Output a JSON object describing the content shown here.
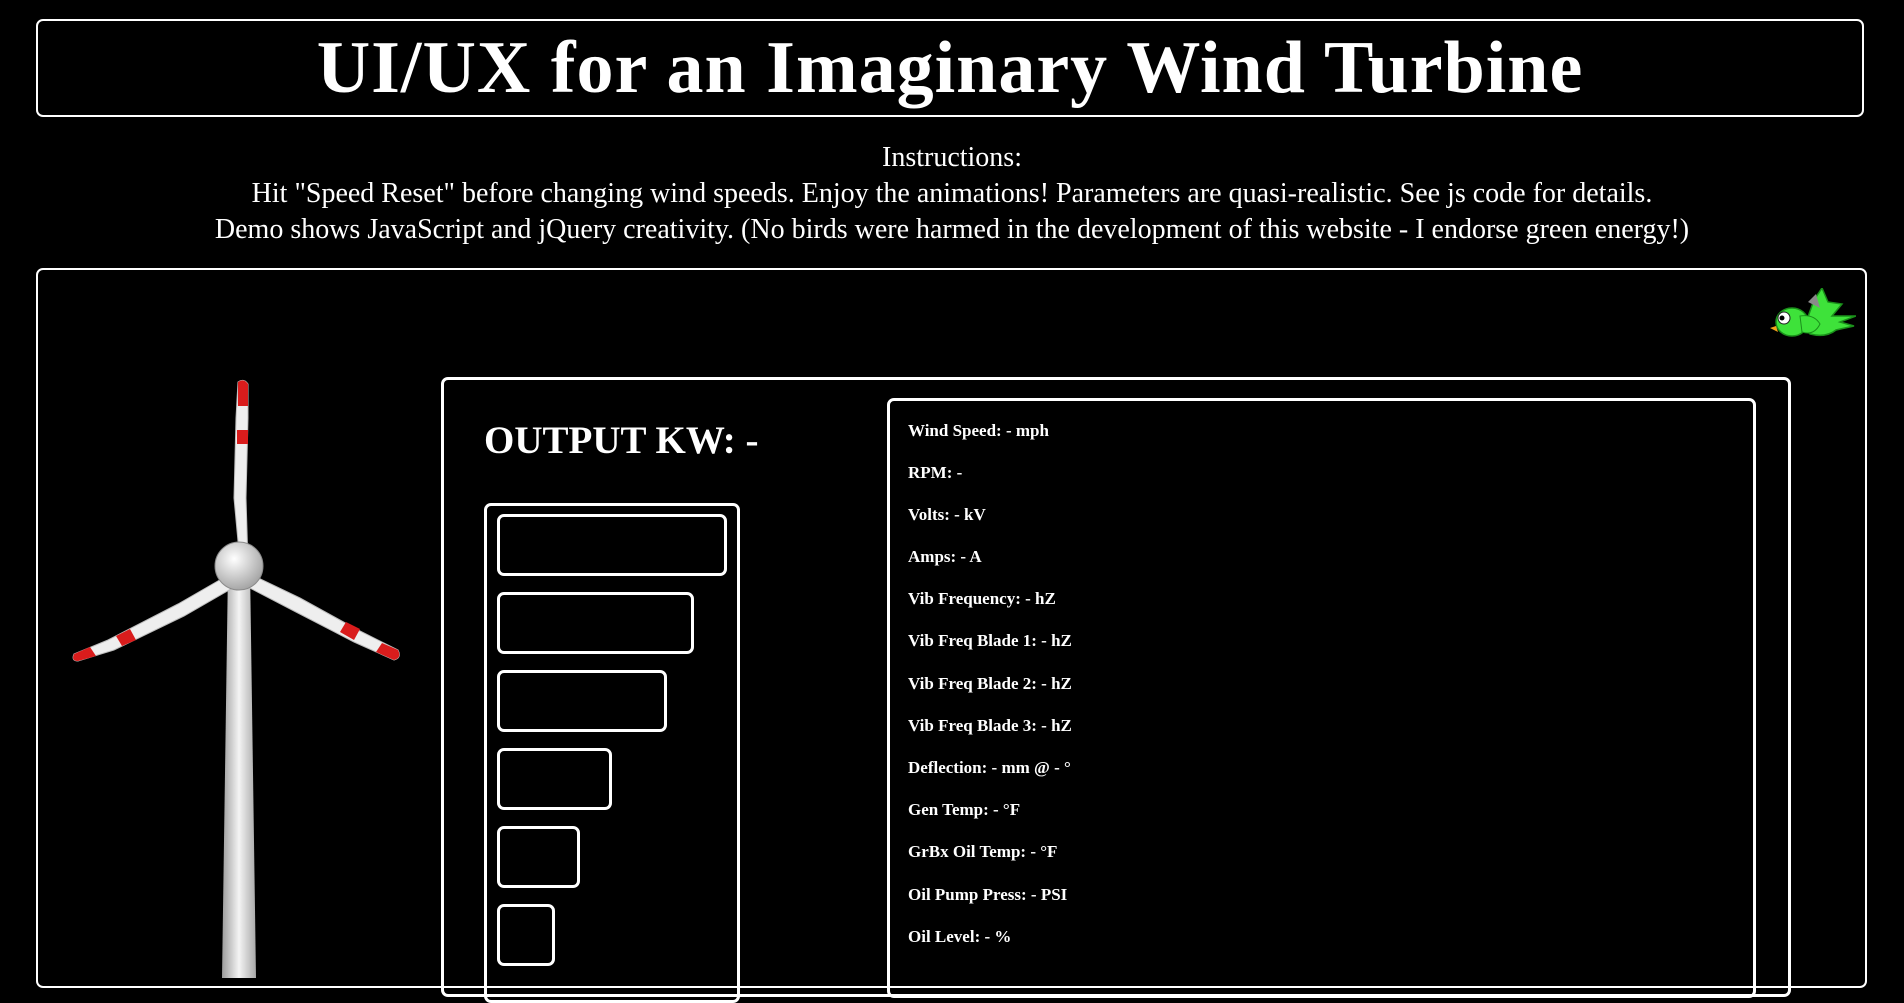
{
  "header": {
    "title": "UI/UX for an Imaginary Wind Turbine"
  },
  "instructions": {
    "heading": "Instructions:",
    "line1": "Hit \"Speed Reset\" before changing wind speeds. Enjoy the animations! Parameters are quasi-realistic. See js code for details.",
    "line2": "Demo shows JavaScript and jQuery creativity. (No birds were harmed in the development of this website - I endorse green energy!)"
  },
  "output": {
    "label": "OUTPUT KW: -"
  },
  "readings": [
    "Wind Speed: - mph",
    "RPM: -",
    "Volts: - kV",
    "Amps: - A",
    "Vib Frequency: - hZ",
    "Vib Freq Blade 1: - hZ",
    "Vib Freq Blade 2: - hZ",
    "Vib Freq Blade 3: - hZ",
    "Deflection: - mm @ - °",
    "Gen Temp: - °F",
    "GrBx Oil Temp: - °F",
    "Oil Pump Press: - PSI",
    "Oil Level: - %"
  ],
  "icons": {
    "bird": "bird-icon",
    "turbine": "wind-turbine-icon"
  },
  "colors": {
    "background": "#000000",
    "foreground": "#ffffff",
    "bird_green": "#3ee23a",
    "blade_tip_red": "#d91c1c"
  }
}
